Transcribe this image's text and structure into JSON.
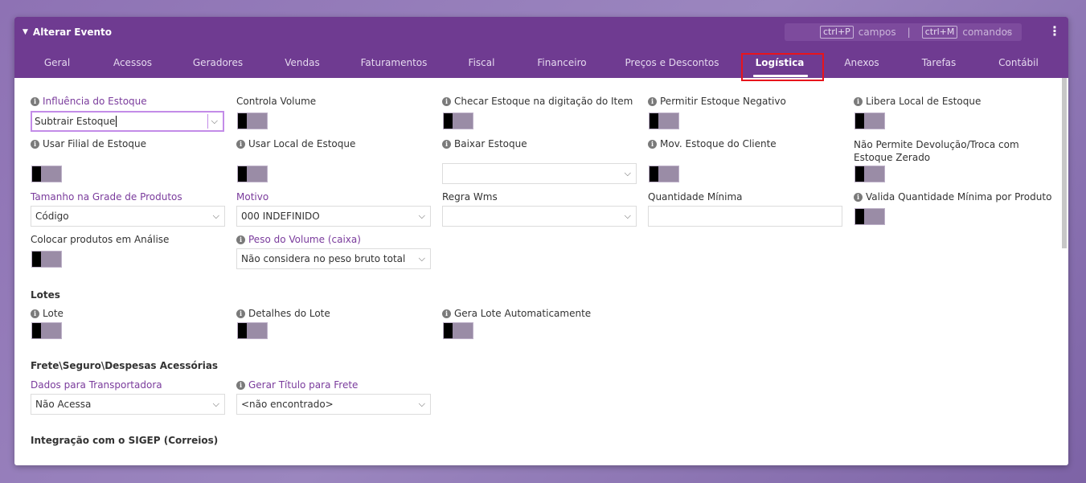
{
  "window": {
    "title": "Alterar Evento",
    "shortcuts": {
      "fields_key": "ctrl+P",
      "fields_label": "campos",
      "separator": "|",
      "commands_key": "ctrl+M",
      "commands_label": "comandos"
    }
  },
  "tabs": [
    "Geral",
    "Acessos",
    "Geradores",
    "Vendas",
    "Faturamentos",
    "Fiscal",
    "Financeiro",
    "Preços e Descontos",
    "Logística",
    "Anexos",
    "Tarefas",
    "Contábil"
  ],
  "active_tab": "Logística",
  "fields": {
    "influencia_estoque": {
      "label": "Influência do Estoque",
      "value": "Subtrair Estoque"
    },
    "controla_volume": {
      "label": "Controla Volume"
    },
    "checar_estoque": {
      "label": "Checar Estoque na digitação do Item"
    },
    "permitir_negativo": {
      "label": "Permitir Estoque Negativo"
    },
    "libera_local": {
      "label": "Libera Local de Estoque"
    },
    "usar_filial": {
      "label": "Usar Filial de Estoque"
    },
    "usar_local": {
      "label": "Usar Local de Estoque"
    },
    "baixar_estoque": {
      "label": "Baixar Estoque",
      "value": ""
    },
    "mov_estoque_cliente": {
      "label": "Mov. Estoque do Cliente"
    },
    "nao_permite_devolucao": {
      "label": "Não Permite Devolução/Troca com Estoque Zerado"
    },
    "tamanho_grade": {
      "label": "Tamanho na Grade de Produtos",
      "value": "Código"
    },
    "motivo": {
      "label": "Motivo",
      "value": "000 INDEFINIDO"
    },
    "regra_wms": {
      "label": "Regra Wms",
      "value": ""
    },
    "quantidade_minima": {
      "label": "Quantidade Mínima",
      "value": ""
    },
    "valida_qtd_minima": {
      "label": "Valida Quantidade Mínima por Produto"
    },
    "colocar_analise": {
      "label": "Colocar produtos em Análise"
    },
    "peso_volume": {
      "label": "Peso do Volume (caixa)",
      "value": "Não considera no peso bruto total"
    }
  },
  "lotes": {
    "title": "Lotes",
    "lote": {
      "label": "Lote"
    },
    "detalhes_lote": {
      "label": "Detalhes do Lote"
    },
    "gera_lote": {
      "label": "Gera Lote Automaticamente"
    }
  },
  "frete": {
    "title": "Frete\\Seguro\\Despesas Acessórias",
    "dados_transportadora": {
      "label": "Dados para Transportadora",
      "value": "Não Acessa"
    },
    "gerar_titulo_frete": {
      "label": "Gerar Título para Frete",
      "value": "<não encontrado>"
    }
  },
  "sigep": {
    "title": "Integração com o SIGEP (Correios)"
  },
  "icons": {
    "info": "i",
    "chevron": "⌵",
    "caret": "▼",
    "kebab": "⋮"
  },
  "colors": {
    "header": "#6f3b91",
    "purple_label": "#7a3b9c",
    "highlight": "#e8141c",
    "focus": "#c38ce8"
  }
}
